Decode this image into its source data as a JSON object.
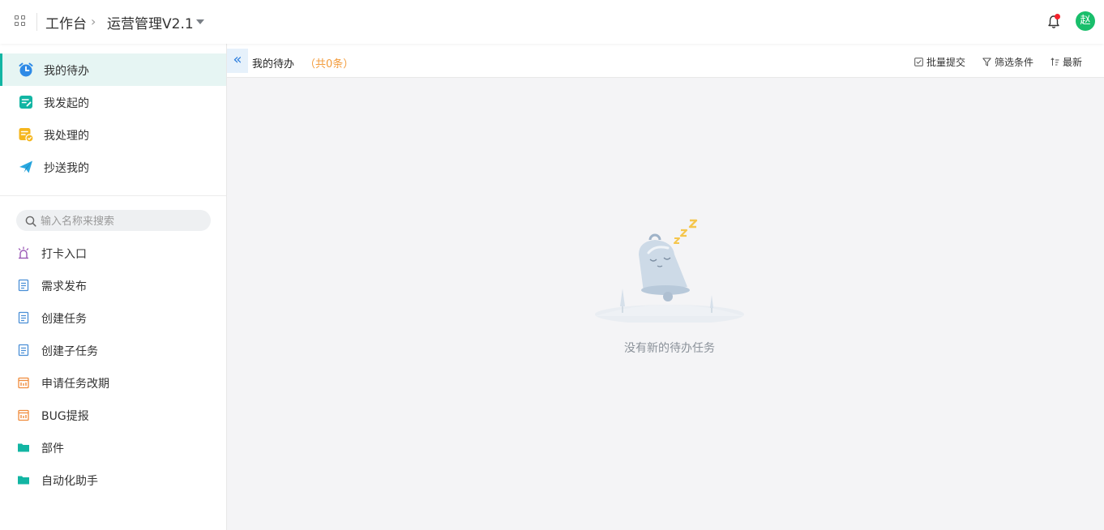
{
  "header": {
    "breadcrumb_root": "工作台",
    "breadcrumb_current": "运营管理V2.1",
    "avatar_text": "赵"
  },
  "sidebar": {
    "nav": [
      {
        "label": "我的待办",
        "icon": "alarm-clock-icon",
        "color": "#2e8ae6"
      },
      {
        "label": "我发起的",
        "icon": "edit-note-icon",
        "color": "#12b5a3"
      },
      {
        "label": "我处理的",
        "icon": "done-task-icon",
        "color": "#f5b61d"
      },
      {
        "label": "抄送我的",
        "icon": "paper-plane-icon",
        "color": "#29a8e0"
      }
    ],
    "search_placeholder": "输入名称来搜索",
    "apps": [
      {
        "label": "打卡入口",
        "icon": "alarm-light-icon",
        "color": "#9b59b6"
      },
      {
        "label": "需求发布",
        "icon": "document-icon",
        "color": "#4a8fd6"
      },
      {
        "label": "创建任务",
        "icon": "document-icon",
        "color": "#4a8fd6"
      },
      {
        "label": "创建子任务",
        "icon": "document-icon",
        "color": "#4a8fd6"
      },
      {
        "label": "申请任务改期",
        "icon": "calendar-form-icon",
        "color": "#f08c3c"
      },
      {
        "label": "BUG提报",
        "icon": "calendar-form-icon",
        "color": "#f08c3c"
      },
      {
        "label": "部件",
        "icon": "folder-icon",
        "color": "#12b5a3"
      },
      {
        "label": "自动化助手",
        "icon": "folder-icon",
        "color": "#12b5a3"
      }
    ]
  },
  "main": {
    "title": "我的待办",
    "count": "（共0条）",
    "actions": [
      {
        "label": "批量提交",
        "icon": "checkbox-icon"
      },
      {
        "label": "筛选条件",
        "icon": "filter-icon"
      },
      {
        "label": "最新",
        "icon": "sort-icon"
      }
    ],
    "empty_text": "没有新的待办任务"
  },
  "colors": {
    "accent": "#12b5a3",
    "active_bg": "#e6f5f3",
    "count_orange": "#f39c3c",
    "badge_red": "#f5222d",
    "avatar_green": "#19be6b"
  }
}
